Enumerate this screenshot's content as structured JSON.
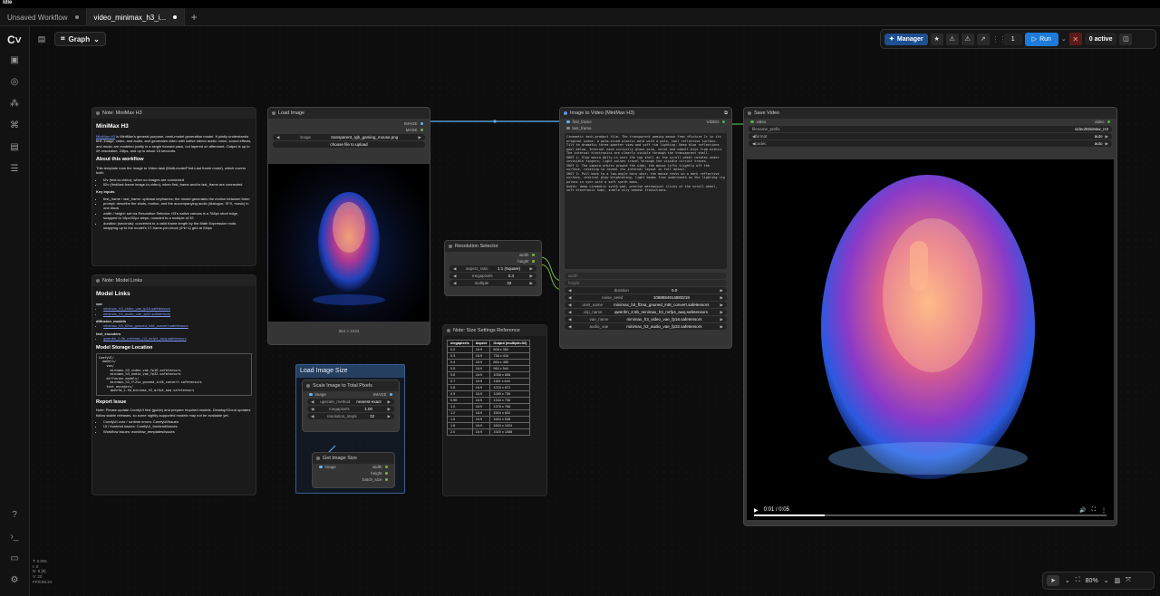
{
  "app": {
    "title": "Idle"
  },
  "tabs": [
    {
      "label": "Unsaved Workflow",
      "active": false
    },
    {
      "label": "video_minimax_h3_i...",
      "active": true
    }
  ],
  "topbar": {
    "graph_label": "Graph"
  },
  "toolbar": {
    "manager_label": "Manager",
    "queue_count": "1",
    "run_label": "Run",
    "active_label": "0 active"
  },
  "note_minimax": {
    "title": "Note: MiniMax H3",
    "heading": "MiniMax H3",
    "intro_link": "MiniMax H3",
    "intro": "is MiniMax's general-purpose, omni-model generation model. It jointly understands text, image, video, and audio, and generates video with native stereo audio: voice, sound effects, and music are modeled jointly in a single forward pass, not layered on afterward. Output is up to 2K resolution, 24fps, and up to about 15 seconds.",
    "about_heading": "About this workflow",
    "about_text": "This template runs the Image to Video task (Multi-mode/First-Last frame mode), which covers both:",
    "bullets": [
      "t2v (text-to-video), when no images are connected",
      "fl2v (first/last-frame image-to-video), when first_frame and/or last_frame are connected"
    ],
    "key_inputs_heading": "Key inputs",
    "key_inputs": [
      "first_frame / last_frame: optional keyframes; the model generates the motion between them",
      "prompt: describe the shots, motion, and the accompanying audio (dialogue, SFX, music) in one block",
      "width / height: set via Resolution Selector. H3's native canvas is a 768px short edge, snapped to 16px/32px steps, rounded to a multiple of 32",
      "duration (seconds): converted to a valid frame length by the Math Expression node, snapping up to the model's 17-frame-per-block (4*k+1) grid at 24fps"
    ]
  },
  "note_models": {
    "title": "Note: Model Links",
    "heading": "Model Links",
    "vae_label": "vae",
    "vae_links": [
      "minimax_h3_video_vae_fp16.safetensors",
      "minimax_h3_audio_vae_fp32.safetensors"
    ],
    "diffusion_label": "diffusion_models",
    "diffusion_links": [
      "minimax_h3_fl2va_gnuned_int8_convert.safetensors"
    ],
    "encoder_label": "text_encoders",
    "encoder_links": [
      "qwenfm_2.5b_minimax_h3_mrfp4_awq.safetensors"
    ],
    "storage_heading": "Model Storage Location",
    "tree": [
      "ComfyUI/",
      "  models/",
      "    vae/",
      "      minimax_h3_video_vae_fp16.safetensors",
      "      minimax_h3_audio_vae_fp32.safetensors",
      "    diffusion_models/",
      "      minimax_h3_fl2va_gnuned_int8_convert.safetensors",
      "    text_encoders/",
      "      qwenfm_2.5b_minimax_h3_mrfp4_awq.safetensors"
    ],
    "report_heading": "Report Issue",
    "report_text": "Note: Please update ComfyUI first (guide) and prepare required models. Desktop/Cloud updates follow stable releases, so some nightly-supported models may not be available yet.",
    "report_items": [
      "ComfyUI core / runtime errors: ComfyUI/issues",
      "UI / frontend issues: ComfyUI_frontend/issues",
      "Workflow issues: workflow_templates/issues"
    ]
  },
  "load_image": {
    "title": "Load Image",
    "out_image": "IMAGE",
    "out_mask": "MASK",
    "image_label": "image",
    "image_value": "transparent_rgb_gaming_mouse.png",
    "upload_label": "choose file to upload",
    "size_text": "864 × 1024"
  },
  "resolution_selector": {
    "title": "Resolution Selector",
    "out_width": "width",
    "out_height": "height",
    "widgets": [
      {
        "label": "aspect_ratio",
        "value": "1:1 (Square)"
      },
      {
        "label": "megapixels",
        "value": "0.4"
      },
      {
        "label": "multiple",
        "value": "32"
      }
    ]
  },
  "size_ref": {
    "title": "Note: Size Settings Reference",
    "headers": [
      "megapixels",
      "Aspect",
      "Output (multiple=32)"
    ],
    "rows": [
      [
        "0.2",
        "16:9",
        "608 x 352"
      ],
      [
        "0.3",
        "16:9",
        "736 x 416"
      ],
      [
        "0.4",
        "16:9",
        "864 x 480"
      ],
      [
        "0.5",
        "16:9",
        "960 x 544"
      ],
      [
        "0.6",
        "16:9",
        "1056 x 608"
      ],
      [
        "0.7",
        "16:9",
        "1152 x 640"
      ],
      [
        "0.8",
        "16:9",
        "1216 x 672"
      ],
      [
        "0.9",
        "16:9",
        "1280 x 736"
      ],
      [
        "0.96",
        "16:9",
        "1344 x 736"
      ],
      [
        "1.0",
        "16:9",
        "1376 x 768"
      ],
      [
        "1.2",
        "16:9",
        "1504 x 832"
      ],
      [
        "1.5",
        "16:9",
        "1664 x 928"
      ],
      [
        "1.8",
        "16:9",
        "1824 x 1024"
      ],
      [
        "2.0",
        "16:9",
        "1920 x 1088"
      ]
    ]
  },
  "group_imagesize": {
    "title": "Load Image Size",
    "scale_title": "Scale Image to Total Pixels",
    "in_image": "image",
    "out_image": "IMAGE",
    "widgets": [
      {
        "label": "upscale_method",
        "value": "nearest-exact"
      },
      {
        "label": "megapixels",
        "value": "1.00"
      },
      {
        "label": "resolution_steps",
        "value": "32"
      }
    ],
    "getsize_title": "Get Image Size",
    "getsize_in": "image",
    "getsize_outs": [
      "width",
      "height",
      "batch_size"
    ]
  },
  "i2v": {
    "title": "Image to Video (MiniMax H3)",
    "in_first": "first_frame",
    "in_last": "last_frame",
    "out_video": "VIDEO",
    "prompt": "Cinematic tech-product film. The transparent gaming mouse from <Picture 1> in its original scene: a palm-sized plastic mold with a pale, cool reflective surface. Tilt to dramatic three-quarter view and soft rim lighting. Deep blue reflections pool below. Internal neon circuitry glows pink, coral and cobalt blue from within. The internal electronics are clearly visible through the transparent shell.\nSHOT 1: Slow macro dolly-in over the top shell as the scroll wheel rotates under invisible fingers; light pulses travel through the visible circuit traces.\nSHOT 2: The camera orbits around the side; the mouse lifts slightly off the surface, rotating to reveal its internal layout in full detail.\nSHOT 3: Pull back to a low-angle hero shot: the mouse rests on a dark reflective surface, internal glow brightening, light beams from underneath as the lighting rig pulses in sync with a soft synth bass.\nAudio: deep cinematic synth pad, precise mechanical clicks of the scroll wheel, soft electronic hums, subtle airy whoosh transitions.",
    "inputs": [
      "width",
      "height"
    ],
    "widgets": [
      {
        "label": "duration",
        "value": "5.0"
      },
      {
        "label": "noise_seed",
        "value": "1088884914883219"
      },
      {
        "label": "unet_name",
        "value": "minimax_h3_fl2va_gnuned_int8_convert.safetensors"
      },
      {
        "label": "clip_name",
        "value": "qwenfm_2.5b_minimax_h3_mrfp4_awq.safetensors"
      },
      {
        "label": "vae_name",
        "value": "minimax_h3_video_vae_fp16.safetensors"
      },
      {
        "label": "audio_vae",
        "value": "minimax_h3_audio_vae_fp32.safetensors"
      }
    ]
  },
  "save_video": {
    "title": "Save Video",
    "in_video": "video",
    "widgets": [
      {
        "label": "filename_prefix",
        "value": "video/MiniMax_H3"
      },
      {
        "label": "format",
        "value": "auto"
      },
      {
        "label": "codec",
        "value": "auto"
      }
    ],
    "time": "0:01 / 0:05",
    "progress": 0.2
  },
  "status": {
    "lines": [
      "T: 0.00s",
      "I: 0",
      "N: 8 [8]",
      "V: 20",
      "FPS:60.24"
    ]
  },
  "bottom": {
    "zoom": "80%"
  },
  "colors": {
    "image_port": "#64b5f6",
    "video_port": "#4caf50",
    "link": "#64b5f6",
    "int_port": "#7cb342",
    "group_border": "#3b5e8f",
    "run": "#1d7cd9"
  }
}
